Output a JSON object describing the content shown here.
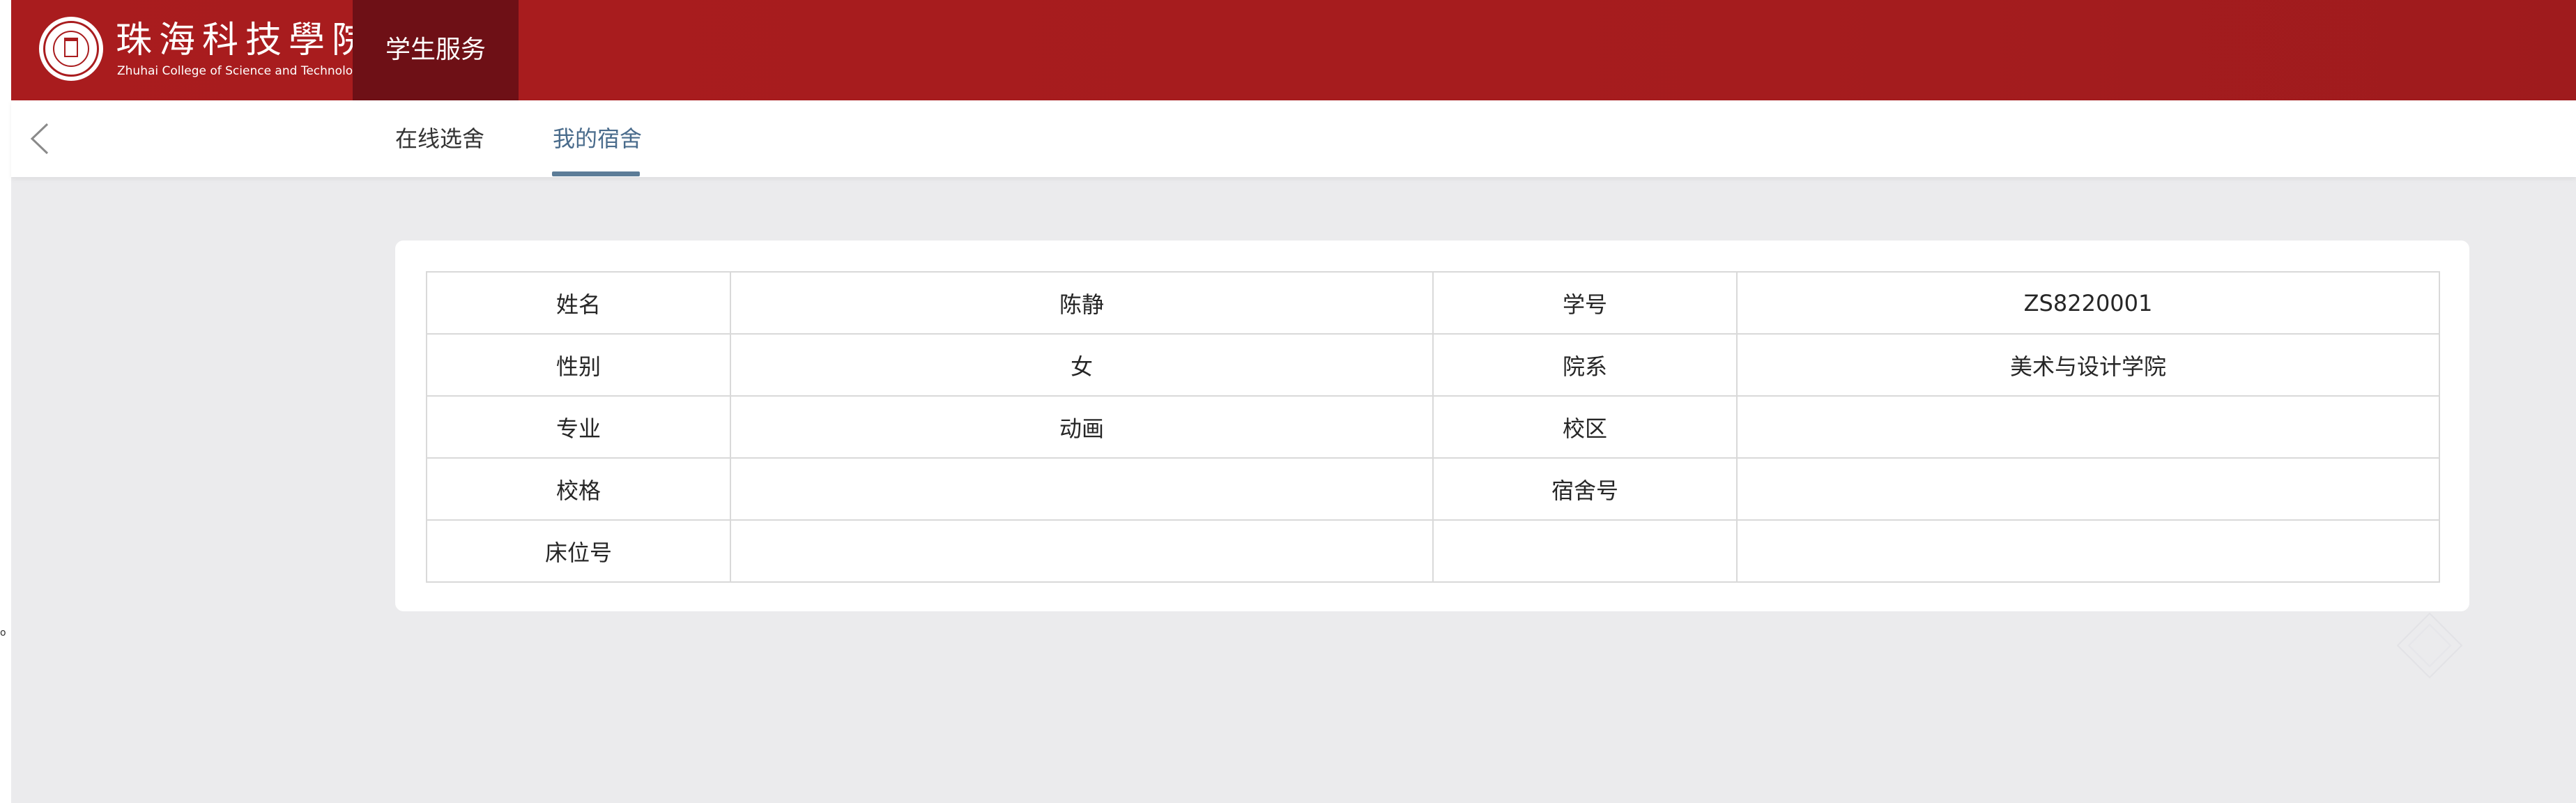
{
  "header": {
    "logo_cn": "珠海科技學院",
    "logo_en": "Zhuhai College of Science and Technology",
    "service_title": "学生服务"
  },
  "edge_mark": "o",
  "tabs": [
    {
      "label": "在线选舍",
      "active": false
    },
    {
      "label": "我的宿舍",
      "active": true
    }
  ],
  "colors": {
    "brand_red": "#a91c1e",
    "service_dark": "#6e1016",
    "active_tab": "#5c7c97"
  },
  "info_table": {
    "rows": [
      {
        "label1": "姓名",
        "value1": "陈静",
        "label2": "学号",
        "value2": "ZS8220001"
      },
      {
        "label1": "性别",
        "value1": "女",
        "label2": "院系",
        "value2": "美术与设计学院"
      },
      {
        "label1": "专业",
        "value1": "动画",
        "label2": "校区",
        "value2": ""
      },
      {
        "label1": "校格",
        "value1": "",
        "label2": "宿舍号",
        "value2": ""
      },
      {
        "label1": "床位号",
        "value1": "",
        "label2": "",
        "value2": ""
      }
    ]
  }
}
